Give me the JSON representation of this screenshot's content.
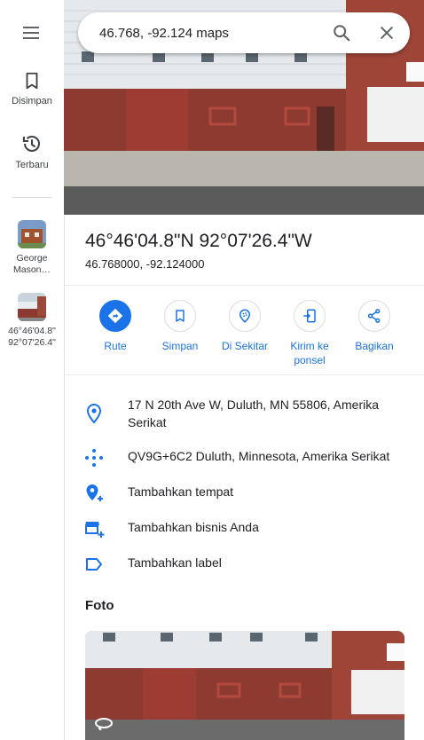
{
  "rail": {
    "saved_label": "Disimpan",
    "recent_label": "Terbaru",
    "recent_items": [
      {
        "label": "George Mason…"
      },
      {
        "label_line1": "46°46'04.8\"",
        "label_line2": "92°07'26.4\""
      }
    ]
  },
  "search": {
    "value": "46.768, -92.124 maps"
  },
  "place": {
    "title": "46°46'04.8\"N 92°07'26.4\"W",
    "decimal": "46.768000, -92.124000"
  },
  "actions": [
    {
      "label": "Rute"
    },
    {
      "label": "Simpan"
    },
    {
      "label": "Di Sekitar"
    },
    {
      "label_line1": "Kirim ke",
      "label_line2": "ponsel"
    },
    {
      "label": "Bagikan"
    }
  ],
  "details": {
    "address": "17 N 20th Ave W, Duluth, MN 55806, Amerika Serikat",
    "plus_code": "QV9G+6C2 Duluth, Minnesota, Amerika Serikat",
    "add_place": "Tambahkan tempat",
    "add_business": "Tambahkan bisnis Anda",
    "add_label": "Tambahkan label"
  },
  "photos": {
    "title": "Foto"
  },
  "colors": {
    "accent": "#1a73e8",
    "brick": "#8a3a30",
    "siding": "#e9ecef"
  }
}
